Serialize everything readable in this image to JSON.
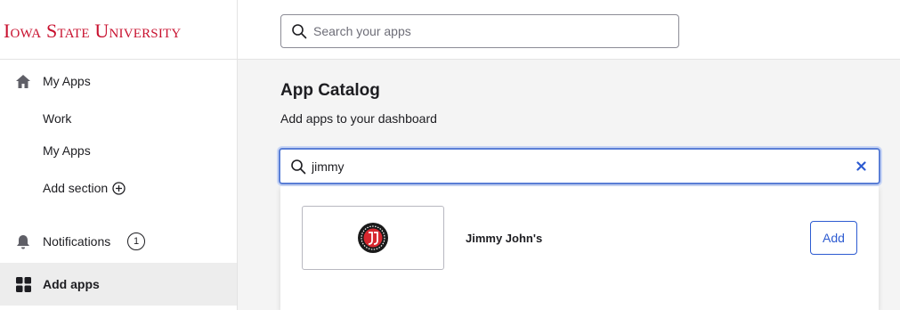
{
  "brand": {
    "logo_text": "Iowa State University",
    "color": "#c8102e"
  },
  "sidebar": {
    "items": [
      {
        "label": "My Apps",
        "icon": "home-icon"
      },
      {
        "label": "Notifications",
        "icon": "bell-icon",
        "badge": "1"
      },
      {
        "label": "Add apps",
        "icon": "grid-icon",
        "active": true
      }
    ],
    "sections": [
      {
        "label": "Work"
      },
      {
        "label": "My Apps"
      }
    ],
    "add_section_label": "Add section"
  },
  "topbar": {
    "search_placeholder": "Search your apps"
  },
  "catalog": {
    "title": "App Catalog",
    "subtitle": "Add apps to your dashboard",
    "search_value": "jimmy",
    "results": [
      {
        "name": "Jimmy John's",
        "logo": "jimmy-johns-logo",
        "action_label": "Add"
      }
    ]
  },
  "colors": {
    "accent": "#2d5bd1",
    "focus_ring": "#5b7fd6",
    "active_bg": "#ededed",
    "main_bg": "#f4f4f4"
  }
}
